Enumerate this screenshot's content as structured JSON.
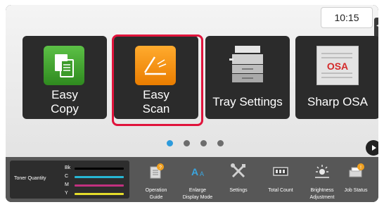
{
  "clock": "10:15",
  "tiles": [
    {
      "label_line1": "Easy",
      "label_line2": "Copy",
      "icon": "easy-copy-icon",
      "color": "#3c9b2a"
    },
    {
      "label_line1": "Easy",
      "label_line2": "Scan",
      "icon": "easy-scan-icon",
      "color": "#f08a00"
    },
    {
      "label": "Tray Settings",
      "icon": "printer-tray-icon"
    },
    {
      "label": "Sharp OSA",
      "icon": "sharp-osa-icon",
      "logo_text": "OSA"
    }
  ],
  "page_indicator": {
    "count": 4,
    "active": 1
  },
  "toner": {
    "title": "Toner Quantity",
    "colors": [
      {
        "name": "Bk",
        "color": "#000000",
        "level": 1.0
      },
      {
        "name": "C",
        "color": "#27b6d4",
        "level": 1.0
      },
      {
        "name": "M",
        "color": "#c1317f",
        "level": 1.0
      },
      {
        "name": "Y",
        "color": "#e4dc2b",
        "level": 1.0
      }
    ]
  },
  "bottom_bar": [
    {
      "label_line1": "Operation",
      "label_line2": "Guide",
      "icon": "operation-guide-icon"
    },
    {
      "label_line1": "Enlarge",
      "label_line2": "Display Mode",
      "icon": "enlarge-display-icon"
    },
    {
      "label_line1": "Settings",
      "label_line2": "",
      "icon": "settings-icon"
    },
    {
      "label_line1": "Total Count",
      "label_line2": "",
      "icon": "total-count-icon"
    },
    {
      "label_line1": "Brightness",
      "label_line2": "Adjustment",
      "icon": "brightness-icon"
    },
    {
      "label_line1": "Job Status",
      "label_line2": "",
      "icon": "job-status-icon"
    }
  ],
  "colors": {
    "highlight": "#e0143c",
    "active_dot": "#2d9bdc"
  }
}
